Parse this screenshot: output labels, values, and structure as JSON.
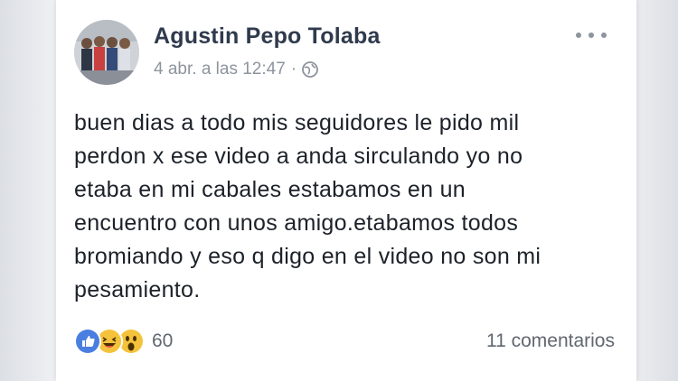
{
  "post": {
    "author_name": "Agustin Pepo Tolaba",
    "timestamp": "4 abr. a las 12:47",
    "separator": "·",
    "privacy_icon": "globe-icon",
    "more_icon": "more-options-icon",
    "text": "buen dias a todo mis seguidores le pido mil\nperdon x ese video a anda sirculando yo no\netaba en mi cabales estabamos en un\nencuentro con unos amigo.etabamos todos\nbromiando y eso q digo en el video no son mi\npesamiento.",
    "reactions": {
      "icons": [
        "like-icon",
        "haha-icon",
        "wow-icon"
      ],
      "count": "60"
    },
    "comments_label": "11 comentarios"
  },
  "colors": {
    "like_blue": "#4a7ee0",
    "reaction_yellow": "#f5c33b",
    "author_text": "#2f3a4d",
    "meta_gray": "#8d949e"
  }
}
